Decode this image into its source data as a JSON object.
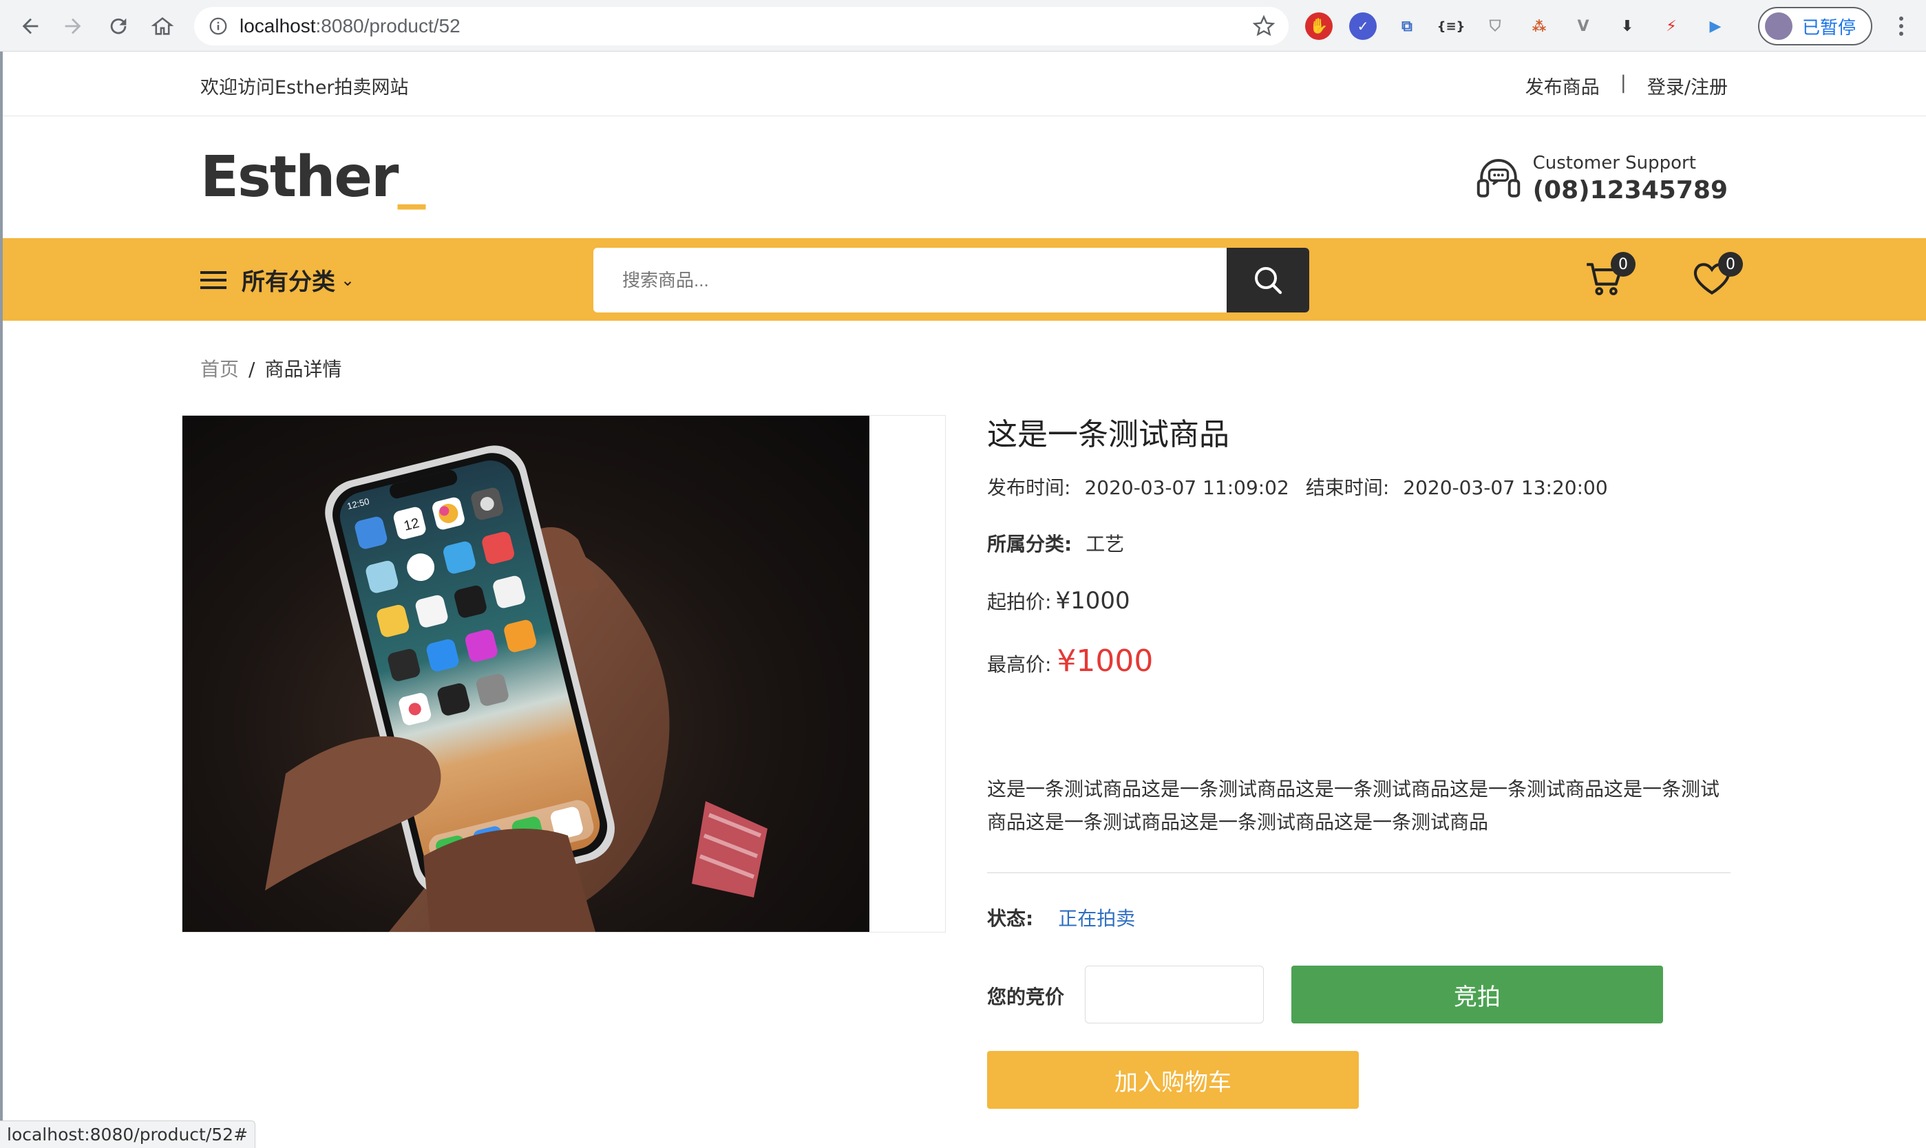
{
  "browser": {
    "url_host": "localhost",
    "url_rest": ":8080/product/52",
    "profile_status": "已暂停",
    "status_url": "localhost:8080/product/52#"
  },
  "topbar": {
    "welcome": "欢迎访问Esther拍卖网站",
    "publish": "发布商品",
    "separator": "|",
    "login": "登录/注册"
  },
  "header": {
    "logo": "Esther",
    "logo_dash": "_",
    "support_label": "Customer Support",
    "support_phone": "(08)12345789"
  },
  "nav": {
    "categories": "所有分类",
    "search_placeholder": "搜索商品...",
    "cart_count": "0",
    "wishlist_count": "0"
  },
  "breadcrumb": {
    "home": "首页",
    "sep": "/",
    "current": "商品详情"
  },
  "product": {
    "title": "这是一条测试商品",
    "publish_label": "发布时间:",
    "publish_time": "2020-03-07 11:09:02",
    "end_label": "结束时间:",
    "end_time": "2020-03-07 13:20:00",
    "category_label": "所属分类:",
    "category": "工艺",
    "start_price_label": "起拍价:",
    "start_price": "¥1000",
    "max_price_label": "最高价:",
    "max_price": "¥1000",
    "description": "这是一条测试商品这是一条测试商品这是一条测试商品这是一条测试商品这是一条测试商品这是一条测试商品这是一条测试商品这是一条测试商品",
    "status_label": "状态:",
    "status": "正在拍卖",
    "bid_label": "您的竞价",
    "bid_value": "",
    "bid_button": "竞拍",
    "cart_button": "加入购物车"
  },
  "phone_screen": {
    "time": "12:50",
    "date_number": "12"
  },
  "colors": {
    "accent": "#f4b73f",
    "bid_green": "#4ca252",
    "price_red": "#e53935",
    "status_blue": "#2f6ec0"
  }
}
